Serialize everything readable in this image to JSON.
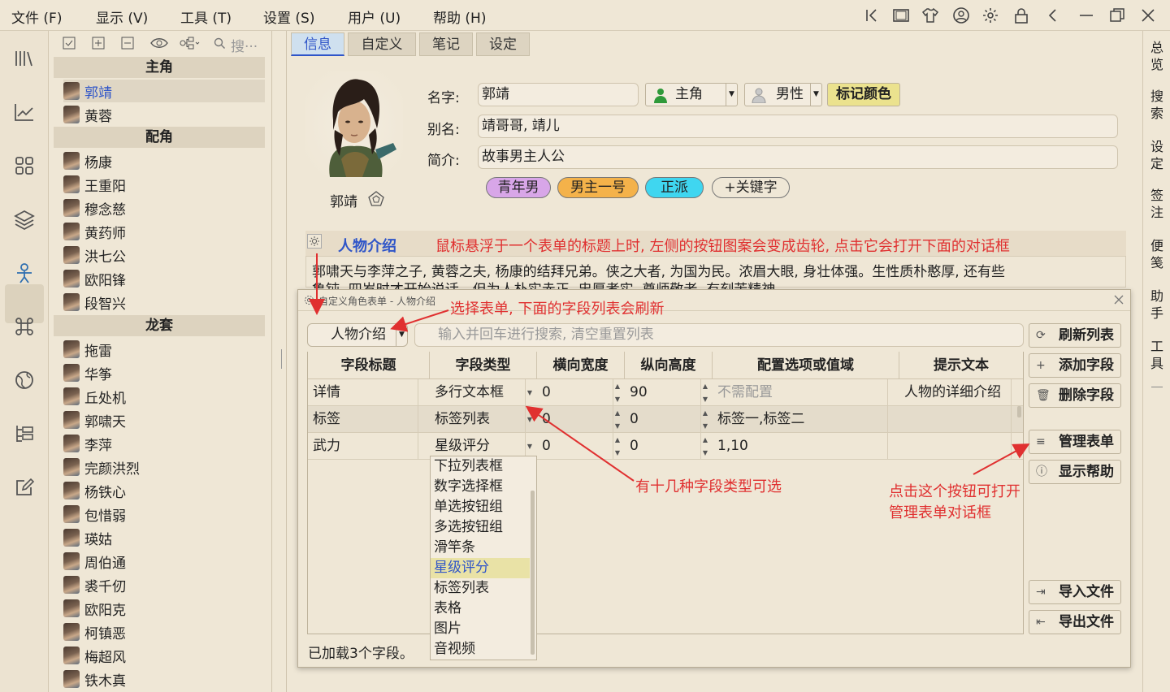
{
  "menu": [
    "文件 (F)",
    "显示 (V)",
    "工具 (T)",
    "设置 (S)",
    "用户 (U)",
    "帮助 (H)"
  ],
  "toolbar_icons": [
    "collapse-left-icon",
    "tablet-icon",
    "shirt-icon",
    "user-circle-icon",
    "gear-icon",
    "lock-icon",
    "collapse-left-icon"
  ],
  "window_controls": [
    "minimize-icon",
    "restore-icon",
    "close-icon"
  ],
  "left_nav_icons": [
    "library-icon",
    "chart-icon",
    "grid-icon",
    "layers-icon",
    "person-icon",
    "command-icon",
    "globe-icon",
    "outline-icon",
    "edit-icon"
  ],
  "tree": {
    "search_placeholder": "搜···",
    "groups": [
      {
        "title": "主角",
        "items": [
          "郭靖",
          "黄蓉"
        ]
      },
      {
        "title": "配角",
        "items": [
          "杨康",
          "王重阳",
          "穆念慈",
          "黄药师",
          "洪七公",
          "欧阳锋",
          "段智兴"
        ]
      },
      {
        "title": "龙套",
        "items": [
          "拖雷",
          "华筝",
          "丘处机",
          "郭啸天",
          "李萍",
          "完颜洪烈",
          "杨铁心",
          "包惜弱",
          "瑛姑",
          "周伯通",
          "裘千仞",
          "欧阳克",
          "柯镇恶",
          "梅超风",
          "铁木真"
        ]
      }
    ],
    "selected": "郭靖"
  },
  "right_strip": [
    "总览",
    "搜索",
    "设定",
    "签注",
    "便笺",
    "助手",
    "工具"
  ],
  "tabs": [
    "信息",
    "自定义",
    "笔记",
    "设定"
  ],
  "active_tab": "信息",
  "character": {
    "portrait_caption": "郭靖",
    "name_label": "名字:",
    "name": "郭靖",
    "role": "主角",
    "gender": "男性",
    "mark_color_label": "标记颜色",
    "alias_label": "别名:",
    "alias": "靖哥哥, 靖儿",
    "intro_label": "简介:",
    "intro": "故事男主人公",
    "tags": [
      {
        "label": "青年男",
        "color": "#d8a6e8"
      },
      {
        "label": "男主一号",
        "color": "#f4b24a"
      },
      {
        "label": "正派",
        "color": "#3fd6f0"
      }
    ],
    "add_keyword": "+关键字"
  },
  "section": {
    "title": "人物介绍",
    "text": "郭啸天与李萍之子, 黄蓉之夫, 杨康的结拜兄弟。侠之大者, 为国为民。浓眉大眼, 身壮体强。生性质朴憨厚, 还有些",
    "text2": "鲁钝, 四岁时才开始说话。但为人朴实赤正, 忠厚孝实, 尊师敬老, 有刻苦精神。"
  },
  "dialog": {
    "title": "自定义角色表单 - 人物介绍",
    "form_select": "人物介绍",
    "search_placeholder": "输入并回车进行搜索, 清空重置列表",
    "columns": [
      "字段标题",
      "字段类型",
      "横向宽度",
      "纵向高度",
      "配置选项或值域",
      "提示文本"
    ],
    "rows": [
      {
        "title": "详情",
        "type": "多行文本框",
        "width": "0",
        "height": "90",
        "config": "不需配置",
        "hint": "人物的详细介绍"
      },
      {
        "title": "标签",
        "type": "标签列表",
        "width": "0",
        "height": "0",
        "config": "标签一,标签二",
        "hint": ""
      },
      {
        "title": "武力",
        "type": "星级评分",
        "width": "0",
        "height": "0",
        "config": "1,10",
        "hint": ""
      }
    ],
    "type_options": [
      "下拉列表框",
      "数字选择框",
      "单选按钮组",
      "多选按钮组",
      "滑竿条",
      "星级评分",
      "标签列表",
      "表格",
      "图片",
      "音视频"
    ],
    "highlighted_option": "星级评分",
    "status": "已加载3个字段。",
    "buttons": {
      "refresh": "刷新列表",
      "add": "添加字段",
      "delete": "删除字段",
      "manage": "管理表单",
      "help": "显示帮助",
      "import": "导入文件",
      "export": "导出文件"
    }
  },
  "annotations": {
    "hover_gear": "鼠标悬浮于一个表单的标题上时, 左侧的按钮图案会变成齿轮, 点击它会打开下面的对话框",
    "select_form": "选择表单, 下面的字段列表会刷新",
    "field_types": "有十几种字段类型可选",
    "manage_btn_line1": "点击这个按钮可打开",
    "manage_btn_line2": "管理表单对话框"
  },
  "colors": {
    "accent": "#2f55c8",
    "annotation": "#e03030",
    "background": "#efe7d6"
  }
}
